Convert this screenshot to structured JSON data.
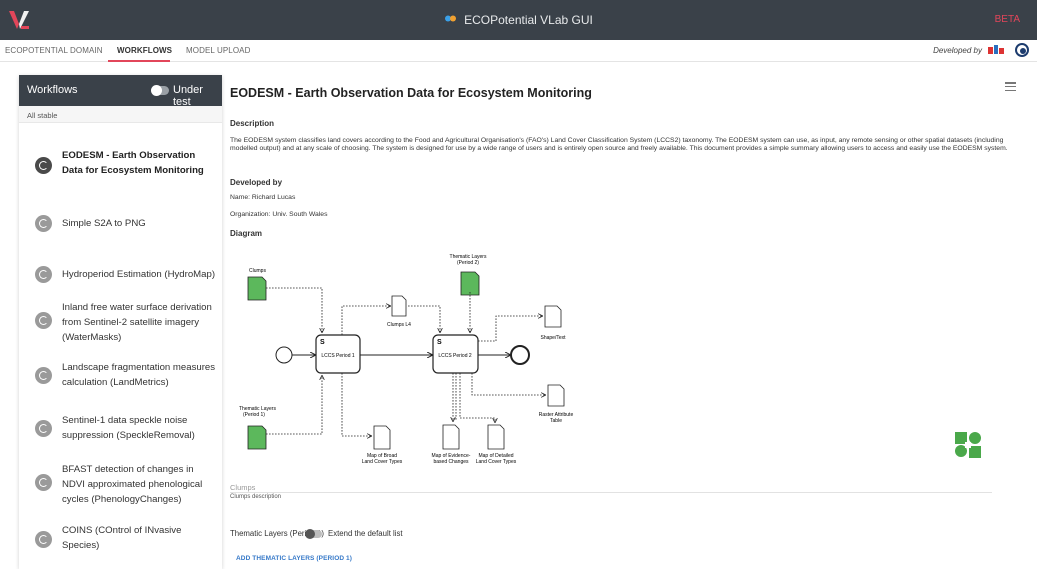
{
  "header": {
    "title": "ECOPotential VLab GUI",
    "beta_badge": "BETA",
    "brand_color": "#e2465a"
  },
  "tabs": [
    {
      "label": "ECOPOTENTIAL DOMAIN"
    },
    {
      "label": "WORKFLOWS",
      "active": true
    },
    {
      "label": "MODEL UPLOAD"
    }
  ],
  "developed_by": "Developed by",
  "sidebar": {
    "title": "Workflows",
    "toggle_label": "Under test",
    "filter_label": "All stable",
    "items": [
      {
        "label": "EODESM - Earth Observation Data for Ecosystem Monitoring",
        "active": true
      },
      {
        "label": "Simple S2A to PNG"
      },
      {
        "label": "Hydroperiod Estimation (HydroMap)"
      },
      {
        "label": "Inland free water surface derivation from Sentinel-2 satellite imagery (WaterMasks)"
      },
      {
        "label": "Landscape fragmentation measures calculation (LandMetrics)"
      },
      {
        "label": "Sentinel-1 data speckle noise suppression (SpeckleRemoval)"
      },
      {
        "label": "BFAST detection of changes in NDVI approximated phenological cycles (PhenologyChanges)"
      },
      {
        "label": "COINS (COntrol of INvasive Species)"
      }
    ]
  },
  "main": {
    "title": "EODESM - Earth Observation Data for Ecosystem Monitoring",
    "description_heading": "Description",
    "description": "The EODESM system classifies land covers according to the Food and Agricultural Organisation's (FAO's) Land Cover Classification System (LCCS2) taxonomy. The EODESM system can use, as input, any remote sensing or other spatial datasets (including modelled output) and at any scale of choosing. The system is designed for use by a wide range of users and is entirely open source and freely available. This document provides a simple summary allowing users to access and easily use the EODESM system.",
    "developed_by_heading": "Developed by",
    "name_line": "Name: Richard Lucas",
    "org_line": "Organization: Univ. South Wales",
    "diagram_heading": "Diagram",
    "diagram": {
      "clumps": "Clumps",
      "thematic_p2_a": "Thematic Layers",
      "thematic_p2_b": "(Period 2)",
      "clumps_l4": "Clumps L4",
      "lccs1": "LCCS Period 1",
      "lccs2": "LCCS Period 2",
      "shape": "Shape/Text",
      "thematic_p1_a": "Thematic Layers",
      "thematic_p1_b": "(Period 1)",
      "raster_a": "Raster Attribute",
      "raster_b": "Table",
      "map_broad_a": "Map of Broad",
      "map_broad_b": "Land Cover Types",
      "map_evid_a": "Map of Evidence-",
      "map_evid_b": "based Changes",
      "map_det_a": "Map of Detailed",
      "map_det_b": "Land Cover Types"
    },
    "field_label": "Clumps",
    "field_description": "Clumps description",
    "thematic_label": "Thematic Layers (Period 1)",
    "extend_label": "Extend the default list",
    "add_button": "ADD THEMATIC LAYERS (PERIOD 1)"
  }
}
